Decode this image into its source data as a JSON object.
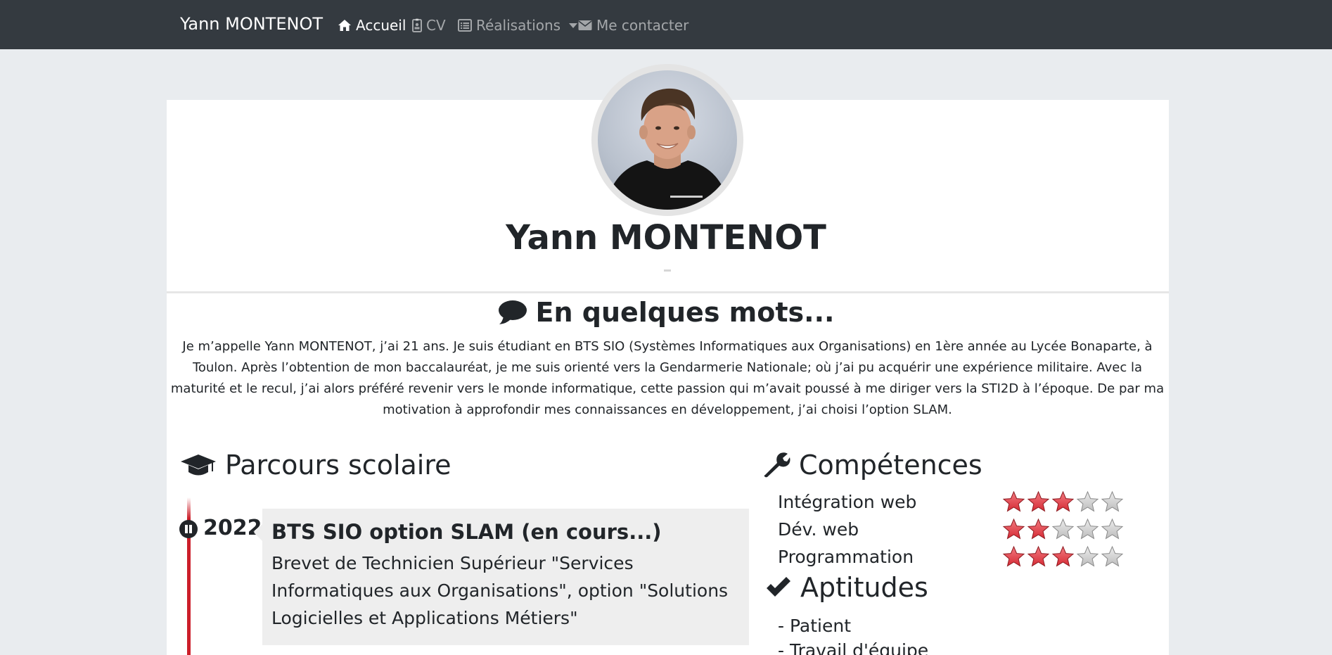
{
  "navbar": {
    "brand": "Yann MONTENOT",
    "items": [
      {
        "label": "Accueil",
        "icon": "home-icon",
        "active": true
      },
      {
        "label": "CV",
        "icon": "id-badge-icon",
        "active": false
      },
      {
        "label": "Réalisations",
        "icon": "list-alt-icon",
        "active": false,
        "dropdown": true
      },
      {
        "label": "Me contacter",
        "icon": "envelope-icon",
        "active": false
      }
    ]
  },
  "profile": {
    "name": "Yann MONTENOT"
  },
  "about": {
    "title": "En quelques mots...",
    "text": "Je m’appelle Yann MONTENOT, j’ai 21 ans. Je suis étudiant en BTS SIO (Systèmes Informatiques aux Organisations) en 1ère année au Lycée Bonaparte, à Toulon. Après l’obtention de mon baccalauréat, je me suis orienté vers la Gendarmerie Nationale; où j’ai pu acquérir une expérience militaire. Avec la maturité et le recul, j’ai alors préféré revenir vers le monde informatique, cette passion qui m’avait poussé à me diriger vers la STI2D à l’époque. De par ma motivation à approfondir mes connaissances en développement, j’ai choisi l’option SLAM."
  },
  "education": {
    "title": "Parcours scolaire",
    "items": [
      {
        "year": "2022",
        "title": "BTS SIO option SLAM (en cours...)",
        "description": "Brevet de Technicien Supérieur \"Services Informatiques aux Organisations\", option \"Solutions Logicielles et Applications Métiers\""
      }
    ]
  },
  "skills": {
    "title": "Compétences",
    "max_rating": 5,
    "items": [
      {
        "label": "Intégration web",
        "rating": 3
      },
      {
        "label": "Dév. web",
        "rating": 2
      },
      {
        "label": "Programmation",
        "rating": 3
      }
    ]
  },
  "aptitudes": {
    "title": "Aptitudes",
    "items": [
      "- Patient",
      "- Travail d'équipe"
    ]
  },
  "colors": {
    "navbar_bg": "#343a40",
    "page_bg": "#e9ecef",
    "timeline_accent": "#cc1f2a",
    "star_filled": "#d62b35",
    "star_empty": "#bdbdbd"
  }
}
